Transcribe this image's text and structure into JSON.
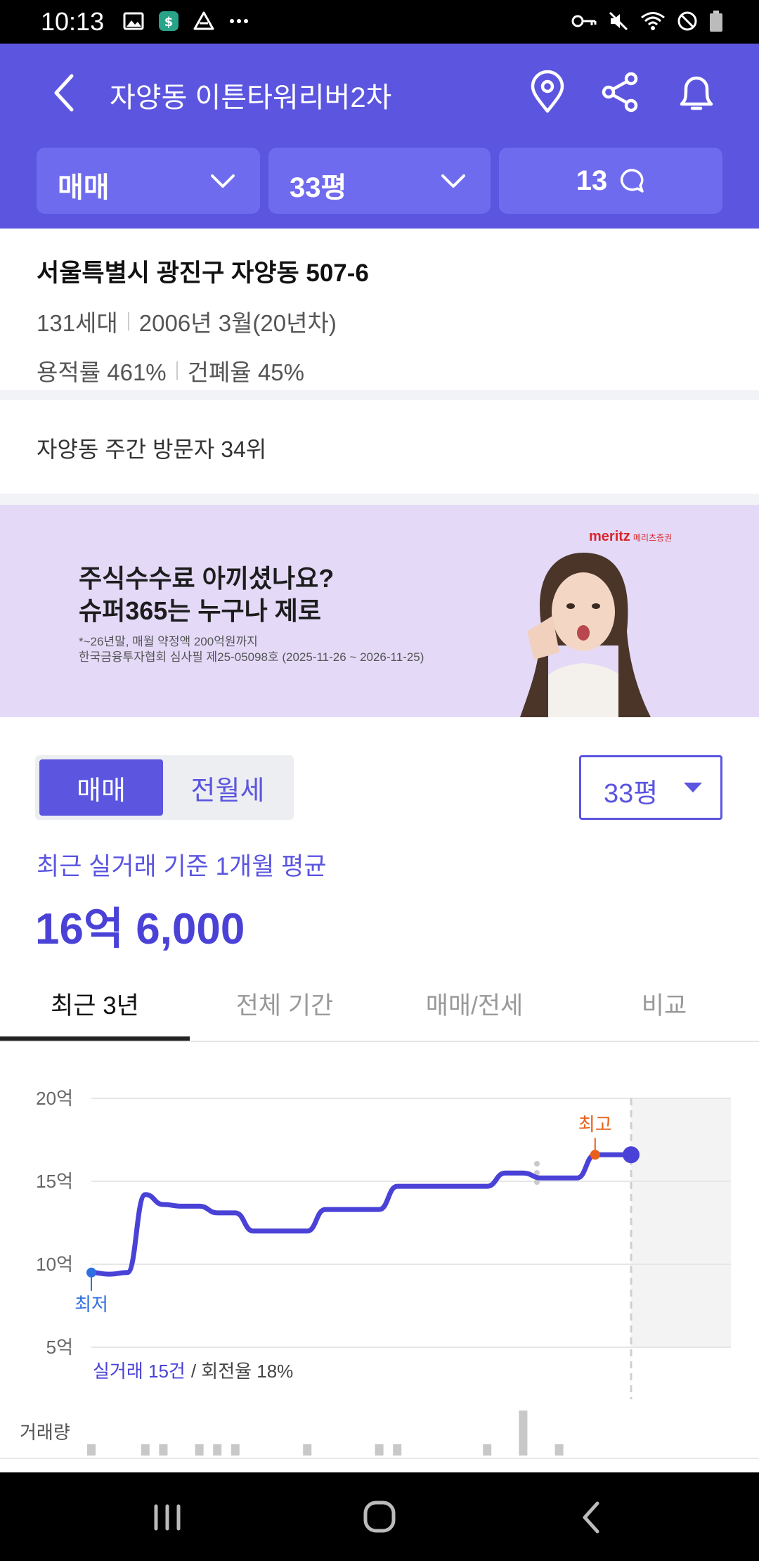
{
  "status_bar": {
    "time": "10:13",
    "left_icons": [
      "image-icon",
      "app-notification-icon",
      "drive-icon",
      "more-dots-icon"
    ],
    "right_icons": [
      "vpn-key-icon",
      "mute-icon",
      "wifi-icon",
      "do-not-disturb-icon",
      "battery-icon"
    ]
  },
  "header": {
    "title": "자양동 이튼타워리버2차",
    "background": "#5b55e0",
    "filters": {
      "trade_type": "매매",
      "size": "33평",
      "comments_count": "13"
    }
  },
  "address": {
    "full": "서울특별시 광진구 자양동 507-6",
    "households": "131세대",
    "built": "2006년 3월(20년차)",
    "floor_area_ratio": "용적률 461%",
    "building_coverage": "건폐율 45%"
  },
  "visitor_rank": "자양동 주간 방문자 34위",
  "ad": {
    "headline_1": "주식수수료 아끼셨나요?",
    "headline_2": "슈퍼365는 누구나 제로",
    "footnote_1": "*~26년말, 매월 약정액 200억원까지",
    "footnote_2": "한국금융투자협회 심사필 제25-05098호 (2025-11-26 ~ 2026-11-25)",
    "brand": "meritz",
    "brand_sub": "메리츠증권"
  },
  "trade_toggle": {
    "active": "매매",
    "inactive": "전월세"
  },
  "size_select": "33평",
  "average": {
    "label": "최근 실거래 기준 1개월 평균",
    "price": "16억 6,000"
  },
  "tabs": [
    {
      "label": "최근 3년",
      "active": true
    },
    {
      "label": "전체 기간",
      "active": false
    },
    {
      "label": "매매/전세",
      "active": false
    },
    {
      "label": "비교",
      "active": false
    }
  ],
  "chart_data": {
    "type": "line",
    "y_ticks": [
      "20억",
      "15억",
      "10억",
      "5억"
    ],
    "ylim": [
      5,
      20
    ],
    "y_unit": "억",
    "series": [
      {
        "values": [
          9.5,
          9.4,
          9.5,
          14.2,
          13.6,
          13.5,
          13.5,
          13.1,
          13.1,
          12.0,
          12.0,
          12.0,
          12.0,
          13.3,
          13.3,
          13.3,
          13.3,
          14.7,
          14.7,
          14.7,
          14.7,
          14.7,
          14.7,
          15.5,
          15.5,
          15.2,
          15.2,
          15.2,
          16.6,
          16.6,
          16.6
        ]
      }
    ],
    "annotations": {
      "max_label": "최고",
      "min_label": "최저"
    },
    "summary": {
      "count_label": "실거래 15건",
      "turnover_label": "/ 회전율 18%"
    },
    "volume_label": "거래량",
    "volume": [
      1,
      0,
      0,
      1,
      1,
      0,
      1,
      1,
      1,
      0,
      0,
      0,
      1,
      0,
      0,
      0,
      1,
      1,
      0,
      0,
      0,
      0,
      1,
      0,
      4,
      0,
      1,
      0,
      0,
      0
    ],
    "colors": {
      "line": "#4a42d6",
      "max": "#e8601c",
      "min": "#2f6fe0"
    }
  },
  "nav_bar": [
    "recent-apps-icon",
    "home-icon",
    "back-icon"
  ]
}
